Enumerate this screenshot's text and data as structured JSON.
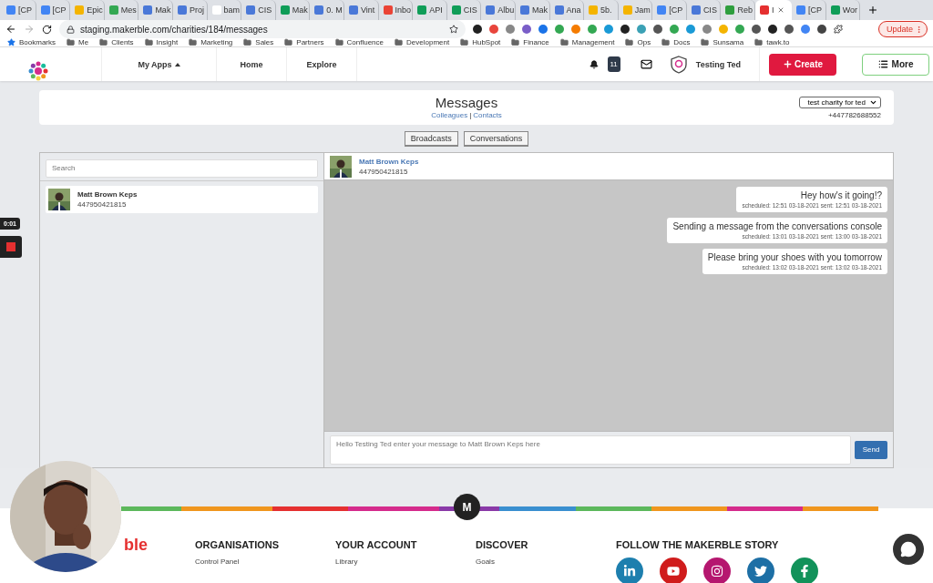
{
  "browser": {
    "tabs": [
      {
        "label": "[CP",
        "selected": false
      },
      {
        "label": "[CP",
        "selected": false
      },
      {
        "label": "Epic",
        "selected": false
      },
      {
        "label": "Mes",
        "selected": false
      },
      {
        "label": "Mak",
        "selected": false
      },
      {
        "label": "Proj",
        "selected": false
      },
      {
        "label": "bam",
        "selected": false
      },
      {
        "label": "CIS",
        "selected": false
      },
      {
        "label": "Mak",
        "selected": false
      },
      {
        "label": "0. M",
        "selected": false
      },
      {
        "label": "Vint",
        "selected": false
      },
      {
        "label": "Inbo",
        "selected": false
      },
      {
        "label": "API",
        "selected": false
      },
      {
        "label": "CIS",
        "selected": false
      },
      {
        "label": "Albu",
        "selected": false
      },
      {
        "label": "Mak",
        "selected": false
      },
      {
        "label": "Ana",
        "selected": false
      },
      {
        "label": "5b.",
        "selected": false
      },
      {
        "label": "Jam",
        "selected": false
      },
      {
        "label": "[CP",
        "selected": false
      },
      {
        "label": "CIS",
        "selected": false
      },
      {
        "label": "Reb",
        "selected": false
      },
      {
        "label": "I",
        "selected": true
      },
      {
        "label": "[CP",
        "selected": false
      },
      {
        "label": "Wor",
        "selected": false
      }
    ],
    "address": "staging.makerble.com/charities/184/messages",
    "update_button": "Update",
    "bookmarks": [
      "Bookmarks",
      "Me",
      "Clients",
      "Insight",
      "Marketing",
      "Sales",
      "Partners",
      "Confluence",
      "Development",
      "HubSpot",
      "Finance",
      "Management",
      "Ops",
      "Docs",
      "Sunsama",
      "tawk.to"
    ]
  },
  "app_header": {
    "nav": [
      {
        "label": "My Apps",
        "selected": false
      },
      {
        "label": "Home",
        "selected": false
      },
      {
        "label": "Explore",
        "selected": false
      }
    ],
    "notification_count": "11",
    "user": "Testing Ted",
    "create_button": "Create",
    "more_button": "More"
  },
  "messages_card": {
    "title": "Messages",
    "links": [
      "Colleagues",
      "Contacts"
    ],
    "separator": "|",
    "charity_select": "test charity for ted",
    "phone": "+447782688552"
  },
  "view_tabs": [
    {
      "label": "Broadcasts",
      "selected": false
    },
    {
      "label": "Conversations",
      "selected": false
    }
  ],
  "contacts_panel": {
    "search_placeholder": "Search",
    "contacts": [
      {
        "name": "Matt Brown Keps",
        "phone": "447950421815"
      }
    ]
  },
  "chat": {
    "contact_name": "Matt Brown Keps",
    "contact_phone": "447950421815",
    "messages": [
      {
        "text": "Hey how's it going!?",
        "meta": "scheduled: 12:51 03-18-2021 sent: 12:51 03-18-2021"
      },
      {
        "text": "Sending a message from the conversations console",
        "meta": "scheduled: 13:01 03-18-2021 sent: 13:00 03-18-2021"
      },
      {
        "text": "Please bring your shoes with you tomorrow",
        "meta": "scheduled: 13:02 03-18-2021 sent: 13:02 03-18-2021"
      }
    ],
    "input_placeholder": "Hello Testing Ted enter your message to Matt Brown Keps here",
    "send_button": "Send"
  },
  "footer": {
    "logo_partial": "ble",
    "marker": "M",
    "columns": [
      {
        "heading": "ORGANISATIONS",
        "links": [
          "Control Panel"
        ]
      },
      {
        "heading": "YOUR ACCOUNT",
        "links": [
          "Library"
        ]
      },
      {
        "heading": "DISCOVER",
        "links": [
          "Goals"
        ]
      }
    ],
    "social_heading": "FOLLOW THE MAKERBLE STORY"
  },
  "recording": {
    "timer": "0:01"
  }
}
